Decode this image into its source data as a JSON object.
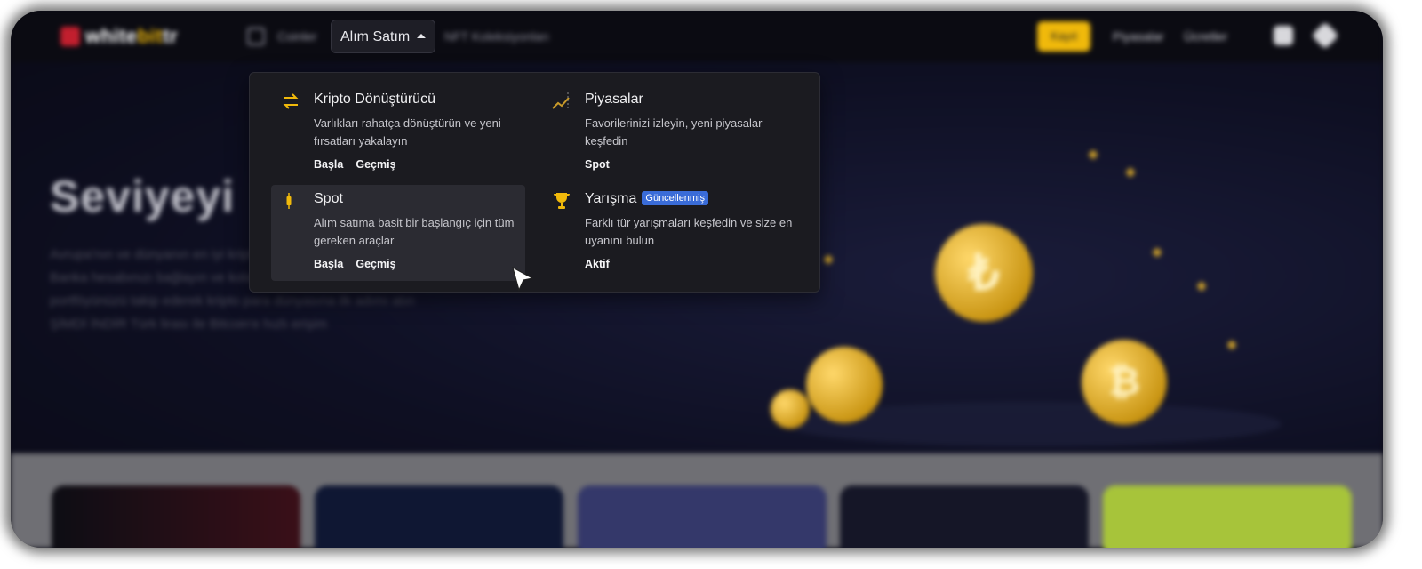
{
  "header": {
    "logo_text_a": "white",
    "logo_text_b": "bit",
    "logo_text_c": "tr",
    "nav_coins": "Coinler",
    "nav_trade": "Alım Satım",
    "nav_nft": "NFT Koleksiyonları",
    "nav_r1": "Piyasalar",
    "nav_r2": "Ücretler",
    "signup": "Kayıt"
  },
  "hero": {
    "title": "Seviyeyi",
    "lines": [
      "Avrupa'nın ve dünyanın en iyi kripto para borsalarından biri",
      "Banka hesabınızı bağlayın ve kolayca yatırım yapın",
      "portföyünüzü takip ederek kripto para dünyasına ilk adımı atın",
      "ŞİMDİ İNDİR Türk lirası ile Bitcoin'e hızlı erişim"
    ]
  },
  "menu": {
    "items": [
      {
        "title": "Kripto Dönüştürücü",
        "desc": "Varlıkları rahatça dönüştürün ve yeni fırsatları yakalayın",
        "links": [
          "Başla",
          "Geçmiş"
        ],
        "icon": "convert-arrows-icon"
      },
      {
        "title": "Piyasalar",
        "desc": "Favorilerinizi izleyin, yeni piyasalar keşfedin",
        "links": [
          "Spot"
        ],
        "icon": "chart-line-icon"
      },
      {
        "title": "Spot",
        "desc": "Alım satıma basit bir başlangıç için tüm gereken araçlar",
        "links": [
          "Başla",
          "Geçmiş"
        ],
        "icon": "candlestick-icon"
      },
      {
        "title": "Yarışma",
        "badge": "Güncellenmiş",
        "desc": "Farklı tür yarışmaları keşfedin ve size en uyanını bulun",
        "links": [
          "Aktif"
        ],
        "icon": "trophy-icon"
      }
    ]
  },
  "colors": {
    "accent": "#f0b90b",
    "menu_bg": "#1b1b20",
    "badge": "#3a6cd8"
  }
}
